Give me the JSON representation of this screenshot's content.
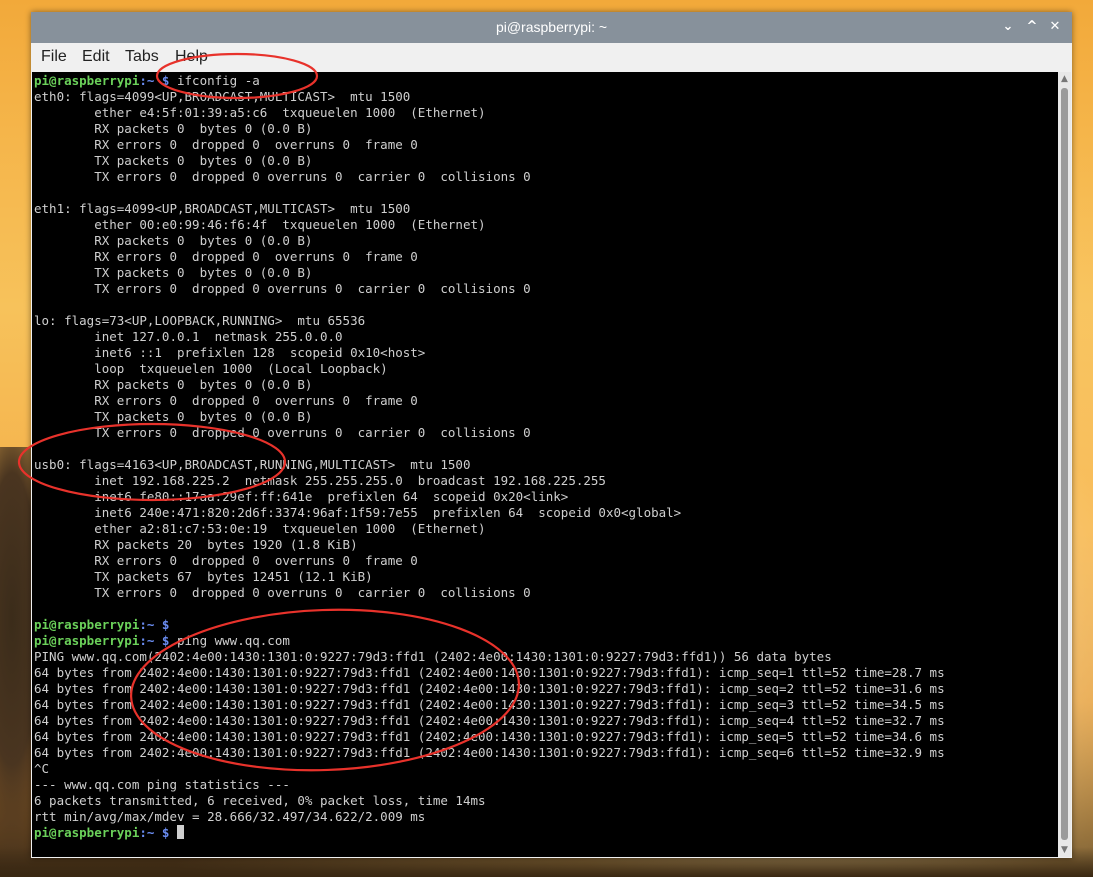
{
  "window": {
    "title": "pi@raspberrypi: ~",
    "controls": [
      "⌄",
      "^",
      "✕"
    ]
  },
  "menu": [
    "File",
    "Edit",
    "Tabs",
    "Help"
  ],
  "prompt": {
    "user": "pi@raspberrypi",
    "path": ":~ $"
  },
  "terminal": {
    "cmd1": "ifconfig -a",
    "ifconfig_output": [
      "eth0: flags=4099<UP,BROADCAST,MULTICAST>  mtu 1500",
      "        ether e4:5f:01:39:a5:c6  txqueuelen 1000  (Ethernet)",
      "        RX packets 0  bytes 0 (0.0 B)",
      "        RX errors 0  dropped 0  overruns 0  frame 0",
      "        TX packets 0  bytes 0 (0.0 B)",
      "        TX errors 0  dropped 0 overruns 0  carrier 0  collisions 0",
      "",
      "eth1: flags=4099<UP,BROADCAST,MULTICAST>  mtu 1500",
      "        ether 00:e0:99:46:f6:4f  txqueuelen 1000  (Ethernet)",
      "        RX packets 0  bytes 0 (0.0 B)",
      "        RX errors 0  dropped 0  overruns 0  frame 0",
      "        TX packets 0  bytes 0 (0.0 B)",
      "        TX errors 0  dropped 0 overruns 0  carrier 0  collisions 0",
      "",
      "lo: flags=73<UP,LOOPBACK,RUNNING>  mtu 65536",
      "        inet 127.0.0.1  netmask 255.0.0.0",
      "        inet6 ::1  prefixlen 128  scopeid 0x10<host>",
      "        loop  txqueuelen 1000  (Local Loopback)",
      "        RX packets 0  bytes 0 (0.0 B)",
      "        RX errors 0  dropped 0  overruns 0  frame 0",
      "        TX packets 0  bytes 0 (0.0 B)",
      "        TX errors 0  dropped 0 overruns 0  carrier 0  collisions 0",
      "",
      "usb0: flags=4163<UP,BROADCAST,RUNNING,MULTICAST>  mtu 1500",
      "        inet 192.168.225.2  netmask 255.255.255.0  broadcast 192.168.225.255",
      "        inet6 fe80::17aa:29ef:ff:641e  prefixlen 64  scopeid 0x20<link>",
      "        inet6 240e:471:820:2d6f:3374:96af:1f59:7e55  prefixlen 64  scopeid 0x0<global>",
      "        ether a2:81:c7:53:0e:19  txqueuelen 1000  (Ethernet)",
      "        RX packets 20  bytes 1920 (1.8 KiB)",
      "        RX errors 0  dropped 0  overruns 0  frame 0",
      "        TX packets 67  bytes 12451 (12.1 KiB)",
      "        TX errors 0  dropped 0 overruns 0  carrier 0  collisions 0",
      ""
    ],
    "cmd2": "",
    "cmd3": "ping www.qq.com",
    "ping_output": [
      "PING www.qq.com(2402:4e00:1430:1301:0:9227:79d3:ffd1 (2402:4e00:1430:1301:0:9227:79d3:ffd1)) 56 data bytes",
      "64 bytes from 2402:4e00:1430:1301:0:9227:79d3:ffd1 (2402:4e00:1430:1301:0:9227:79d3:ffd1): icmp_seq=1 ttl=52 time=28.7 ms",
      "64 bytes from 2402:4e00:1430:1301:0:9227:79d3:ffd1 (2402:4e00:1430:1301:0:9227:79d3:ffd1): icmp_seq=2 ttl=52 time=31.6 ms",
      "64 bytes from 2402:4e00:1430:1301:0:9227:79d3:ffd1 (2402:4e00:1430:1301:0:9227:79d3:ffd1): icmp_seq=3 ttl=52 time=34.5 ms",
      "64 bytes from 2402:4e00:1430:1301:0:9227:79d3:ffd1 (2402:4e00:1430:1301:0:9227:79d3:ffd1): icmp_seq=4 ttl=52 time=32.7 ms",
      "64 bytes from 2402:4e00:1430:1301:0:9227:79d3:ffd1 (2402:4e00:1430:1301:0:9227:79d3:ffd1): icmp_seq=5 ttl=52 time=34.6 ms",
      "64 bytes from 2402:4e00:1430:1301:0:9227:79d3:ffd1 (2402:4e00:1430:1301:0:9227:79d3:ffd1): icmp_seq=6 ttl=52 time=32.9 ms",
      "^C",
      "--- www.qq.com ping statistics ---",
      "6 packets transmitted, 6 received, 0% packet loss, time 14ms",
      "rtt min/avg/max/mdev = 28.666/32.497/34.622/2.009 ms"
    ]
  },
  "colors": {
    "prompt_user": "#6bd15a",
    "prompt_path": "#6a8cf0",
    "annotation": "#e8322b",
    "titlebar": "#87919b"
  }
}
